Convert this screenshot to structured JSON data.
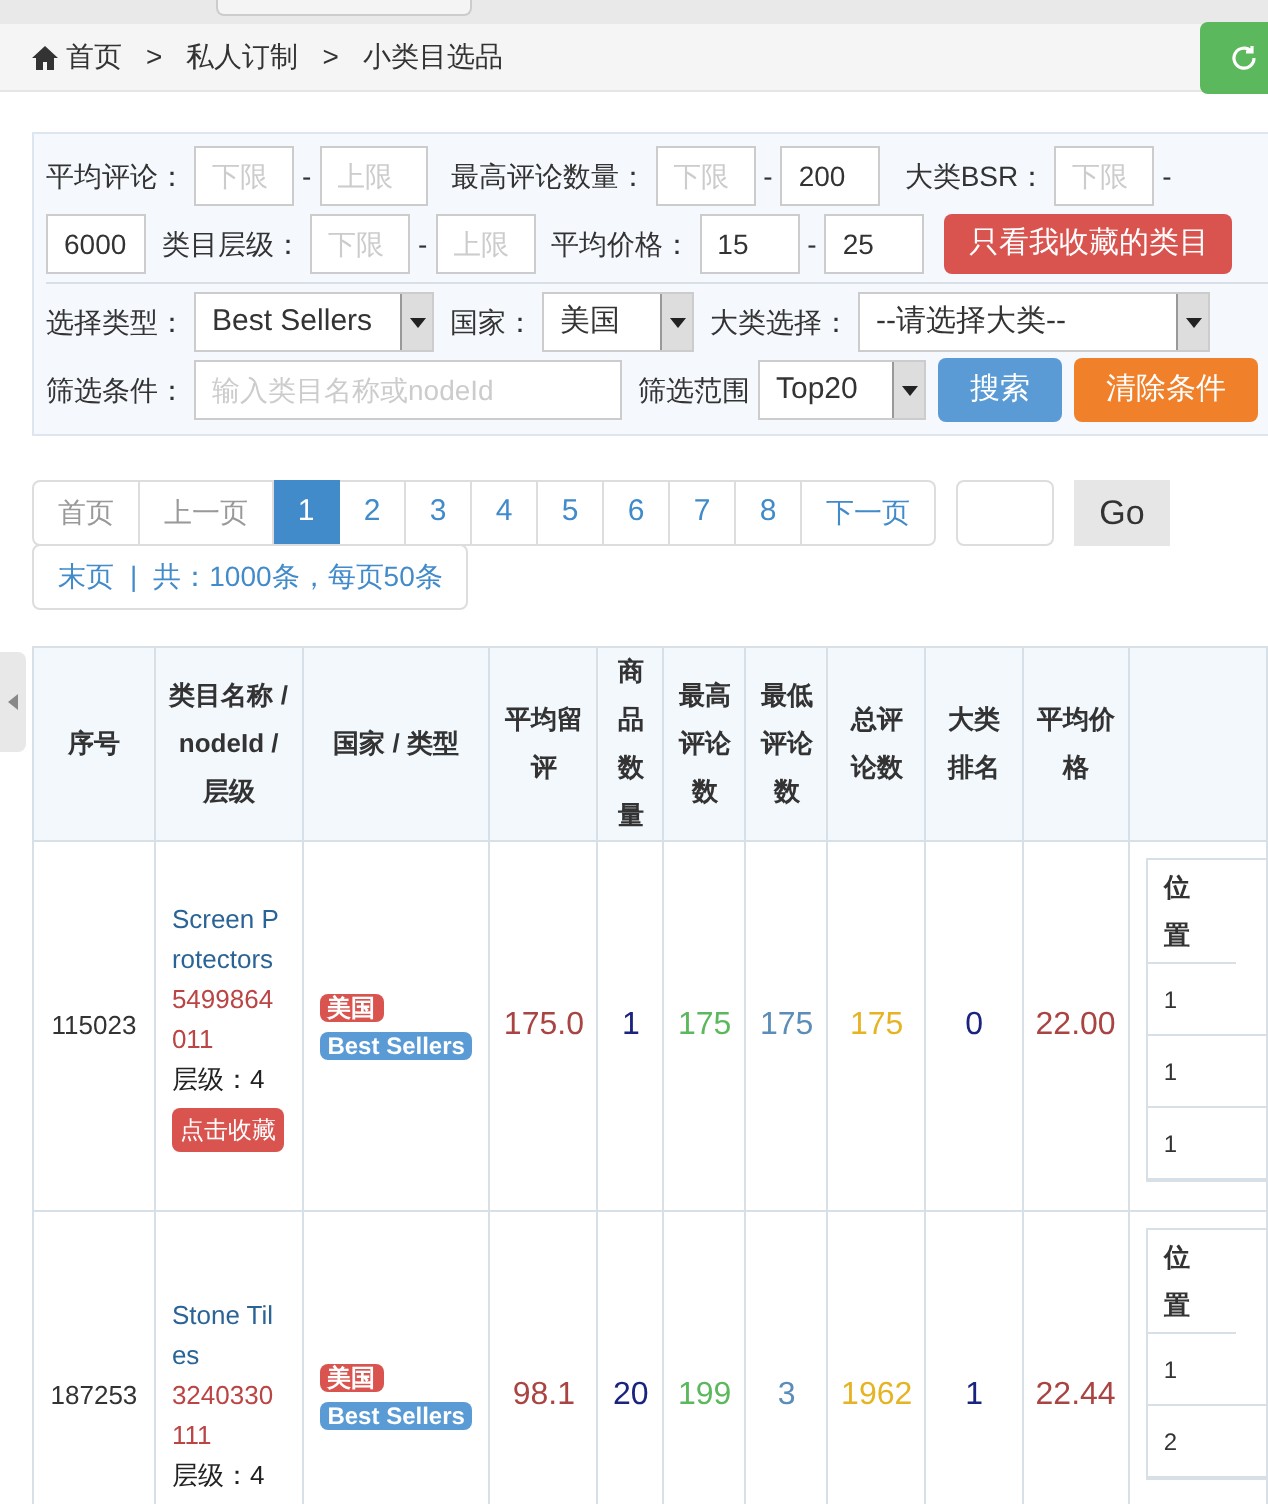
{
  "breadcrumb": {
    "separator": ">",
    "items": [
      "首页",
      "私人订制",
      "小类目选品"
    ]
  },
  "filters": {
    "ranges": [
      {
        "label": "平均评论：",
        "min": {
          "placeholder": "下限"
        },
        "dash": "-",
        "max": {
          "placeholder": "上限"
        }
      },
      {
        "label": "最高评论数量：",
        "min": {
          "placeholder": "下限"
        },
        "dash": "-",
        "max": {
          "value": "200"
        }
      },
      {
        "label": "大类BSR：",
        "min": {
          "placeholder": "下限"
        },
        "dash": "-",
        "max": {
          "value": "6000"
        }
      },
      {
        "label": "类目层级：",
        "min": {
          "placeholder": "下限"
        },
        "dash": "-",
        "max": {
          "placeholder": "上限"
        }
      },
      {
        "label": "平均价格：",
        "min": {
          "value": "15"
        },
        "dash": "-",
        "max": {
          "value": "25"
        }
      }
    ],
    "favorites_button": "只看我收藏的类目",
    "selects": [
      {
        "label": "选择类型：",
        "value": "Best Sellers"
      },
      {
        "label": "国家：",
        "value": "美国"
      },
      {
        "label": "大类选择：",
        "value": "--请选择大类--"
      }
    ],
    "condition": {
      "label": "筛选条件：",
      "placeholder": "输入类目名称或nodeId"
    },
    "scope": {
      "label": "筛选范围",
      "value": "Top20"
    },
    "search_button": "搜索",
    "clear_button": "清除条件"
  },
  "pagination": {
    "first": "首页",
    "prev": "上一页",
    "pages": [
      {
        "label": "1",
        "selected": true
      },
      {
        "label": "2",
        "selected": false
      },
      {
        "label": "3",
        "selected": false
      },
      {
        "label": "4",
        "selected": false
      },
      {
        "label": "5",
        "selected": false
      },
      {
        "label": "6",
        "selected": false
      },
      {
        "label": "7",
        "selected": false
      },
      {
        "label": "8",
        "selected": false
      }
    ],
    "next": "下一页",
    "go": "Go",
    "last": "末页",
    "divider": "|",
    "summary": "共：1000条，每页50条"
  },
  "table": {
    "columns": [
      "序号",
      "类目名称 / nodeId / 层级",
      "国家 / 类型",
      "平均留评",
      "商品数量",
      "最高评论数",
      "最低评论数",
      "总评论数",
      "大类排名",
      "平均价格"
    ],
    "rows": [
      {
        "id": "115023",
        "name": "Screen Protectors",
        "node_id": "5499864011",
        "level": "层级：4",
        "favorite": "点击收藏",
        "country": "美国",
        "type": "Best Sellers",
        "avg_review": "175.0",
        "product_count": "1",
        "max_reviews": "175",
        "min_reviews": "175",
        "total_reviews": "175",
        "rank": "0",
        "avg_price": "22.00",
        "position_header": "位置",
        "positions": [
          "1",
          "1",
          "1"
        ]
      },
      {
        "id": "187253",
        "name": "Stone Tiles",
        "node_id": "3240330111",
        "level": "层级：4",
        "country": "美国",
        "type": "Best Sellers",
        "avg_review": "98.1",
        "product_count": "20",
        "max_reviews": "199",
        "min_reviews": "3",
        "total_reviews": "1962",
        "rank": "1",
        "avg_price": "22.44",
        "position_header": "位置",
        "positions": [
          "1",
          "2"
        ]
      }
    ]
  }
}
